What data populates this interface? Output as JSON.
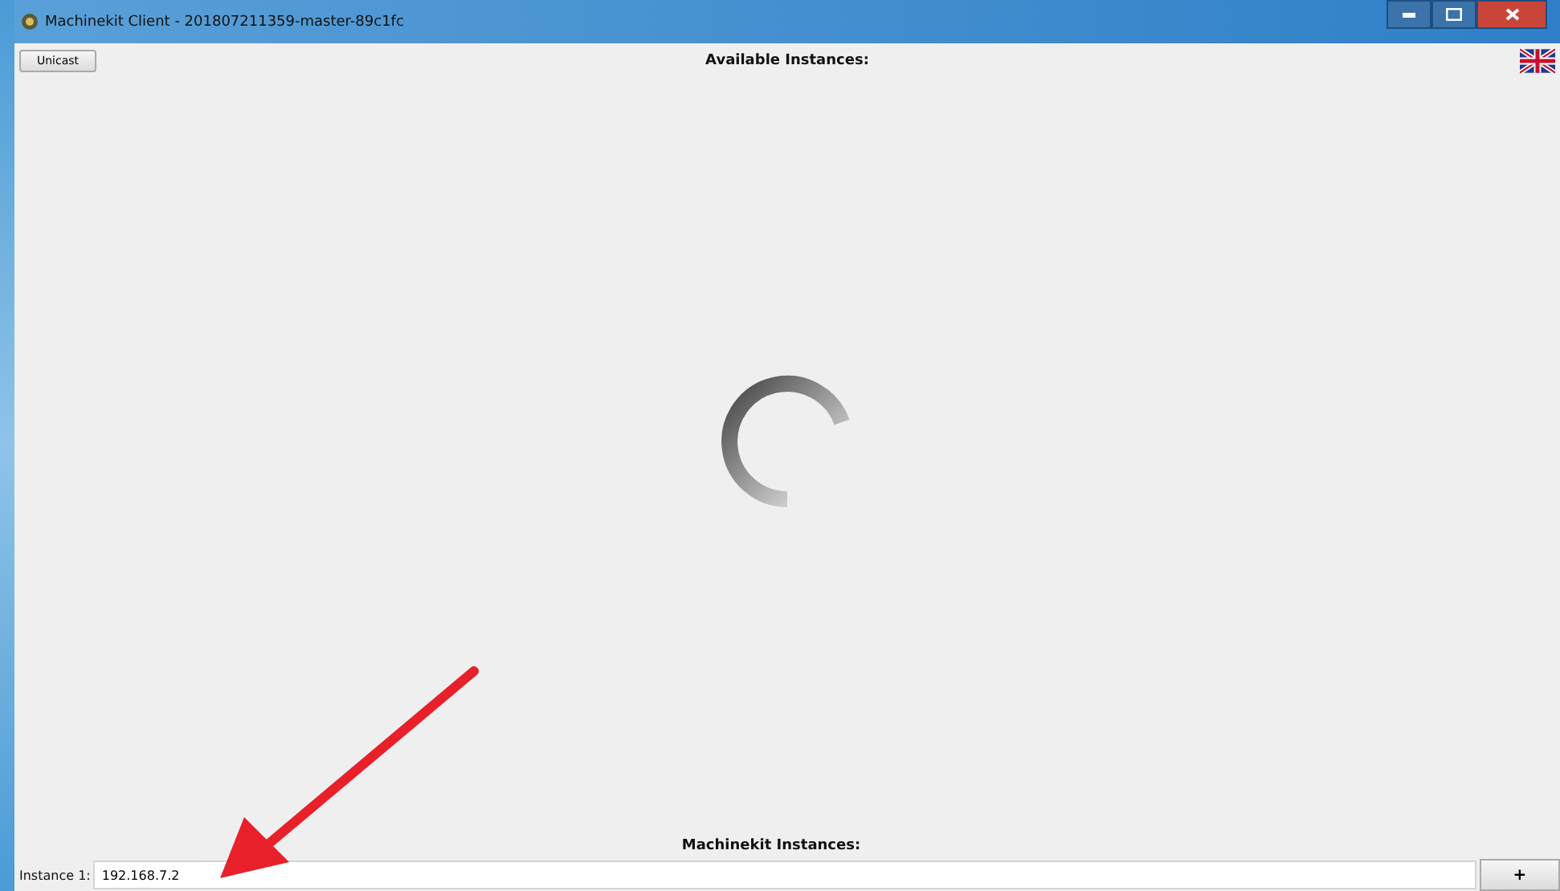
{
  "window": {
    "title": "Machinekit Client - 201807211359-master-89c1fc"
  },
  "toolbar": {
    "unicast_button": "Unicast",
    "heading": "Available Instances:"
  },
  "instances": {
    "heading": "Machinekit Instances:",
    "label": "Instance 1:",
    "value": "192.168.7.2",
    "add_button": "+"
  }
}
